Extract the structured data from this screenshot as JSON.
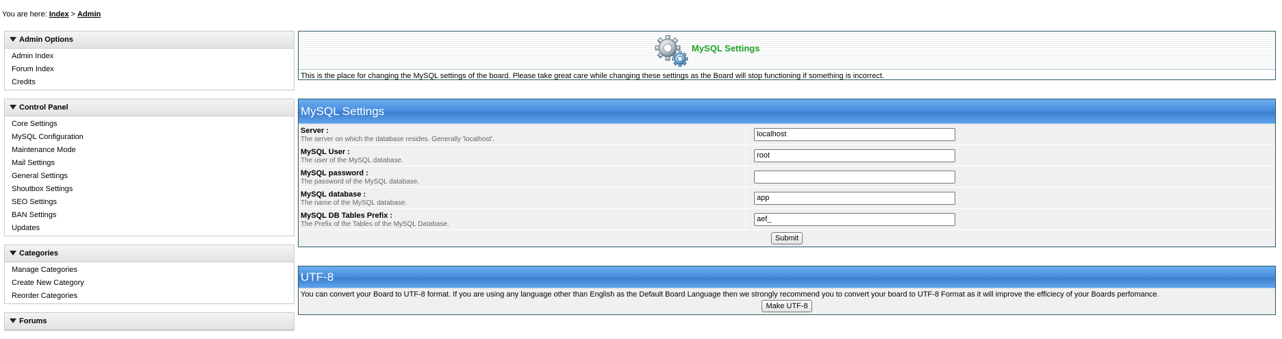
{
  "breadcrumb": {
    "prefix": "You are here:",
    "items": [
      "Index",
      "Admin"
    ],
    "separator": ">"
  },
  "sidebar": {
    "sections": [
      {
        "title": "Admin Options",
        "items": [
          "Admin Index",
          "Forum Index",
          "Credits"
        ]
      },
      {
        "title": "Control Panel",
        "items": [
          "Core Settings",
          "MySQL Configuration",
          "Maintenance Mode",
          "Mail Settings",
          "General Settings",
          "Shoutbox Settings",
          "SEO Settings",
          "BAN Settings",
          "Updates"
        ]
      },
      {
        "title": "Categories",
        "items": [
          "Manage Categories",
          "Create New Category",
          "Reorder Categories"
        ]
      },
      {
        "title": "Forums",
        "items": []
      }
    ]
  },
  "info": {
    "title": "MySQL Settings",
    "text": "This is the place for changing the MySQL settings of the board. Please take great care while changing these settings as the Board will stop functioning if something is incorrect.",
    "icon": "gears-icon"
  },
  "mysql": {
    "header": "MySQL Settings",
    "fields": [
      {
        "label": "Server :",
        "desc": "The server on which the database resides. Generally 'localhost'.",
        "value": "localhost"
      },
      {
        "label": "MySQL User :",
        "desc": "The user of the MySQL database.",
        "value": "root"
      },
      {
        "label": "MySQL password :",
        "desc": "The password of the MySQL database.",
        "value": ""
      },
      {
        "label": "MySQL database :",
        "desc": "The name of the MySQL database.",
        "value": "app"
      },
      {
        "label": "MySQL DB Tables Prefix :",
        "desc": "The Prefix of the Tables of the MySQL Database.",
        "value": "aef_"
      }
    ],
    "submit_label": "Submit"
  },
  "utf8": {
    "header": "UTF-8",
    "text": "You can convert your Board to UTF-8 format. If you are using any language other than English as the Default Board Language then we strongly recommend you to convert your board to UTF-8 Format as it will improve the efficiecy of your Boards perfomance.",
    "button_label": "Make UTF-8"
  },
  "colors": {
    "panel_header": "#4a8fde",
    "info_title": "#22a326",
    "border": "#2b5a66"
  }
}
